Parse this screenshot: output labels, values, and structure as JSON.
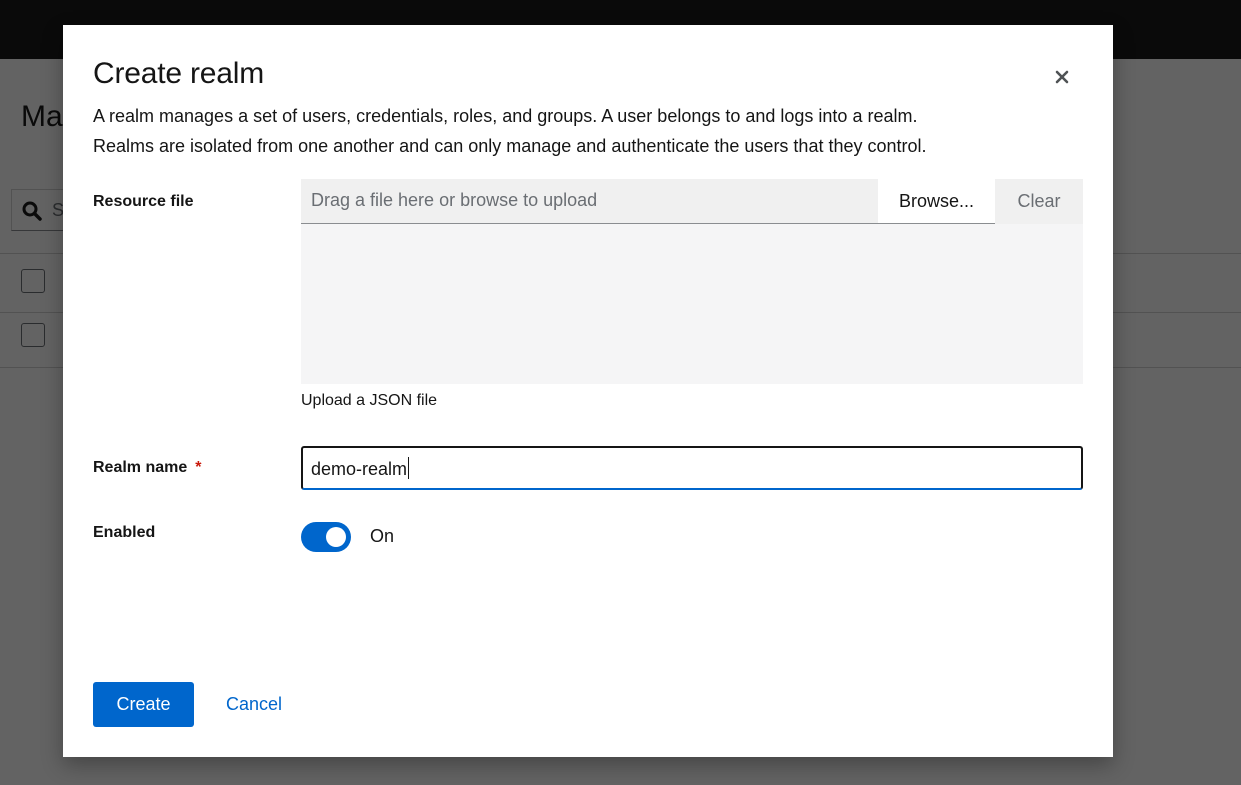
{
  "background": {
    "page_title": "Ma",
    "search_placeholder": "S"
  },
  "modal": {
    "title": "Create realm",
    "description_line1": "A realm manages a set of users, credentials, roles, and groups. A user belongs to and logs into a realm.",
    "description_line2": "Realms are isolated from one another and can only manage and authenticate the users that they control.",
    "close_icon": "close-icon",
    "resource_file": {
      "label": "Resource file",
      "placeholder": "Drag a file here or browse to upload",
      "browse_label": "Browse...",
      "clear_label": "Clear",
      "helper_text": "Upload a JSON file"
    },
    "realm_name": {
      "label": "Realm name",
      "required_marker": "*",
      "value": "demo-realm"
    },
    "enabled": {
      "label": "Enabled",
      "state_label": "On",
      "checked": true
    },
    "buttons": {
      "create_label": "Create",
      "cancel_label": "Cancel"
    }
  },
  "colors": {
    "primary": "#0066cc",
    "required": "#c9190b",
    "masthead": "#151515"
  }
}
